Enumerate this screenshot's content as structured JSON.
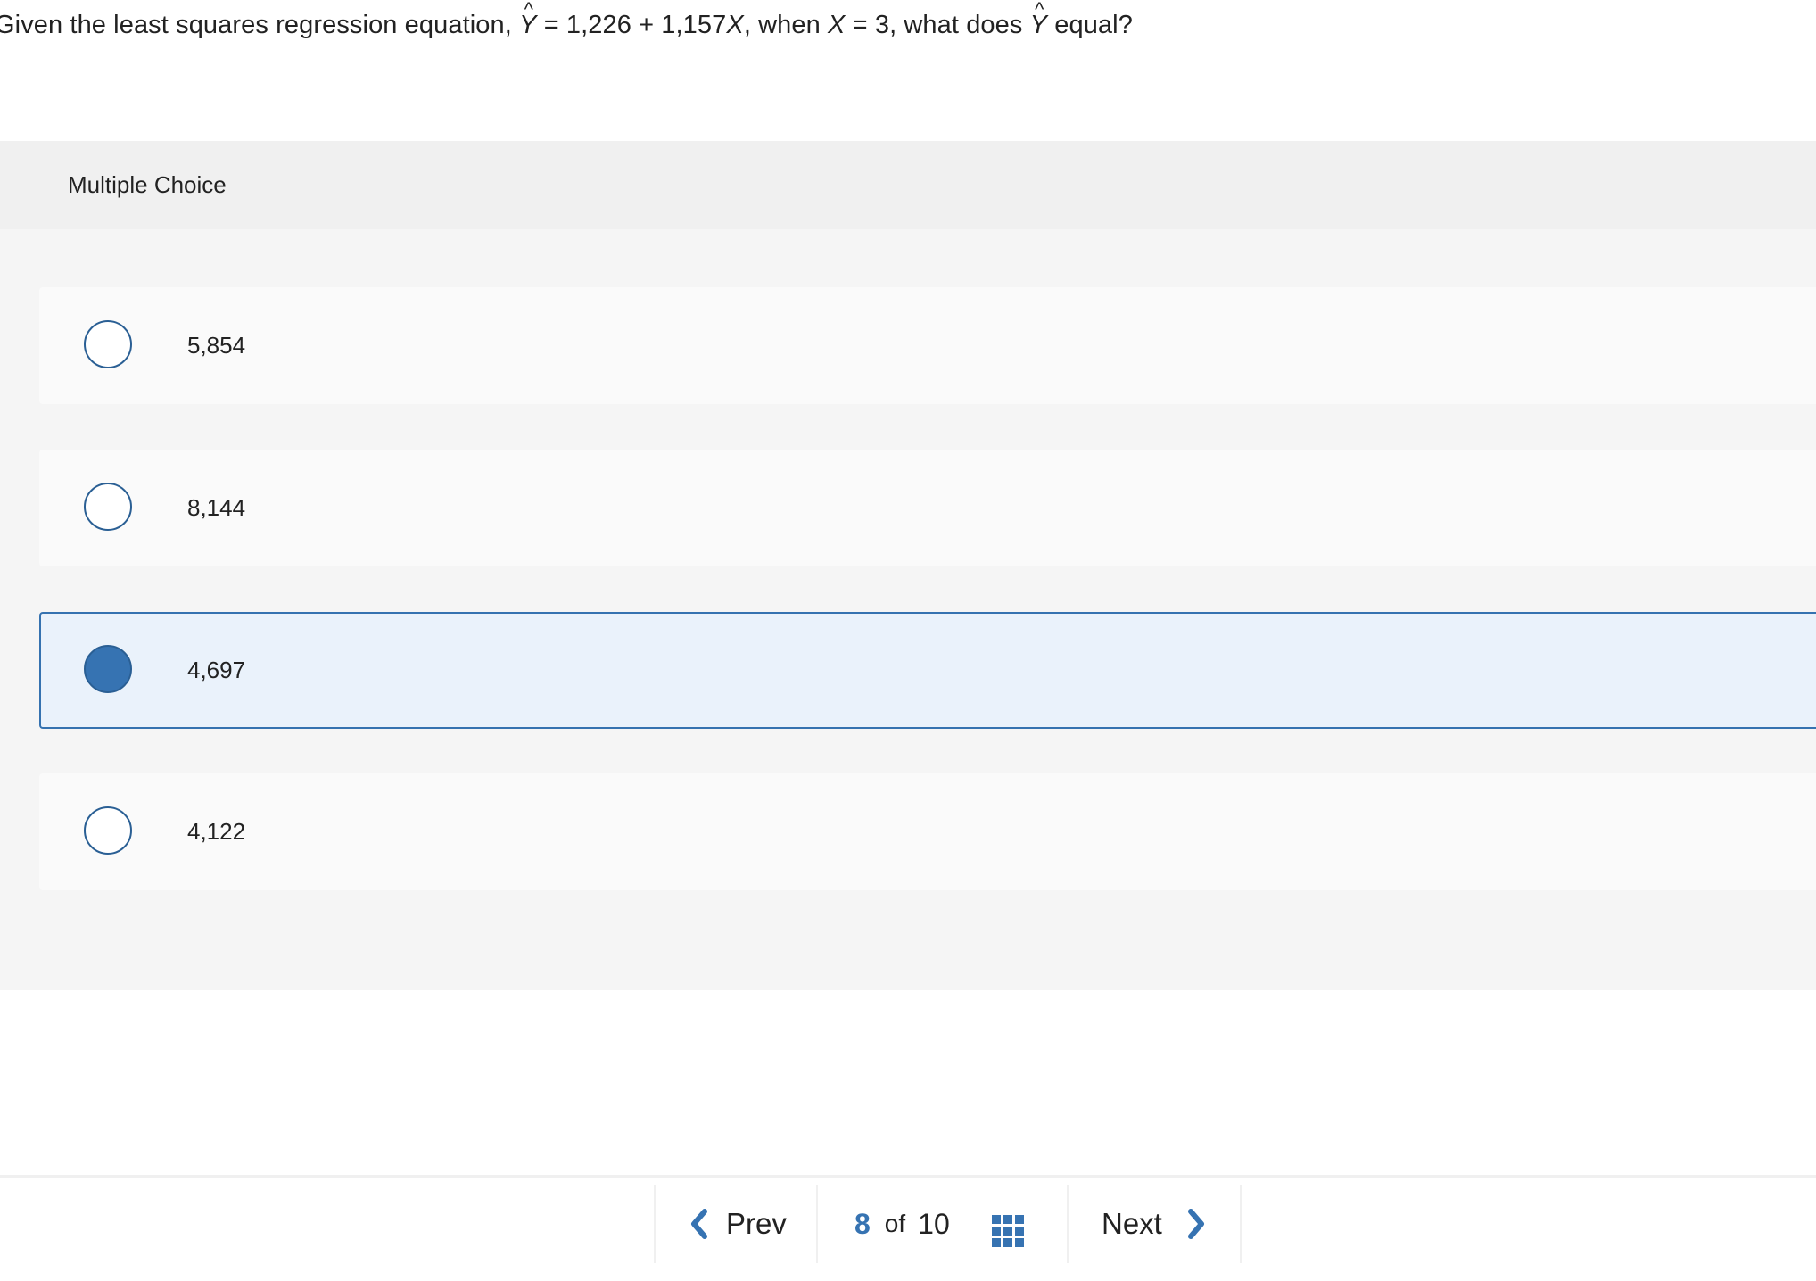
{
  "question": {
    "prefix": "Given the least squares regression equation, ",
    "yhat_symbol": "Y",
    "hat_mark": "^",
    "equation_rest": " = 1,226 + 1,157",
    "x_symbol": "X",
    "middle": ", when ",
    "x_symbol2": "X",
    "condition": " = 3, what does ",
    "yhat_symbol2": "Y",
    "suffix": " equal?"
  },
  "section": {
    "label": "Multiple Choice"
  },
  "options": [
    {
      "label": "5,854",
      "selected": false
    },
    {
      "label": "8,144",
      "selected": false
    },
    {
      "label": "4,697",
      "selected": true
    },
    {
      "label": "4,122",
      "selected": false
    }
  ],
  "navigation": {
    "prev_label": "Prev",
    "next_label": "Next",
    "current_page": "8",
    "of_label": "of",
    "total_pages": "10"
  },
  "colors": {
    "accent": "#3673b2",
    "selected_bg": "#eaf2fb",
    "header_bg": "#f0f0f0",
    "options_bg": "#f5f5f5"
  }
}
